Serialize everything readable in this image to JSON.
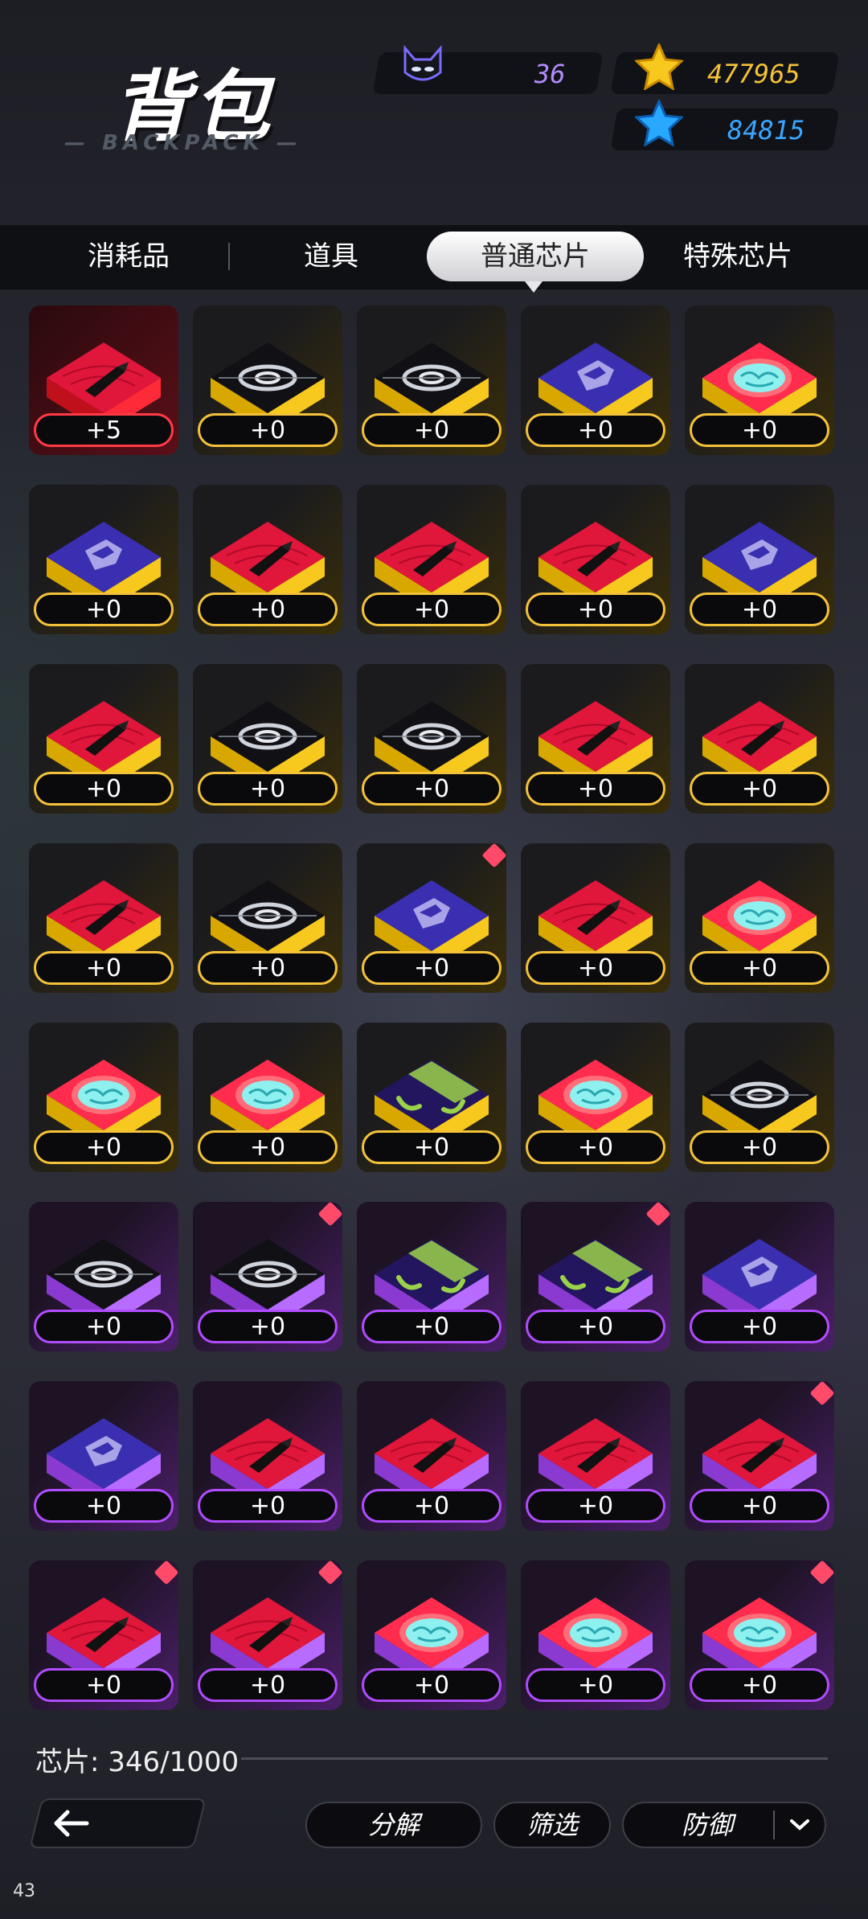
{
  "header": {
    "title": "背包",
    "subtitle": "BACKPACK",
    "energy_value": "36",
    "gold_value": "477965",
    "gem_value": "84815"
  },
  "tabs": [
    {
      "label": "消耗品",
      "active": false
    },
    {
      "label": "道具",
      "active": false
    },
    {
      "label": "普通芯片",
      "active": true
    },
    {
      "label": "特殊芯片",
      "active": false
    }
  ],
  "chips": [
    {
      "icon": "bullet",
      "tier": "red",
      "count": "+5",
      "new": false
    },
    {
      "icon": "vortex",
      "tier": "gold",
      "count": "+0",
      "new": false
    },
    {
      "icon": "vortex",
      "tier": "gold",
      "count": "+0",
      "new": false
    },
    {
      "icon": "shield-logo",
      "tier": "gold",
      "count": "+0",
      "new": false
    },
    {
      "icon": "brain",
      "tier": "gold",
      "count": "+0",
      "new": false
    },
    {
      "icon": "shield-logo",
      "tier": "gold",
      "count": "+0",
      "new": false
    },
    {
      "icon": "bullet",
      "tier": "gold",
      "count": "+0",
      "new": false
    },
    {
      "icon": "bullet",
      "tier": "gold",
      "count": "+0",
      "new": false
    },
    {
      "icon": "bullet",
      "tier": "gold",
      "count": "+0",
      "new": false
    },
    {
      "icon": "shield-logo",
      "tier": "gold",
      "count": "+0",
      "new": false
    },
    {
      "icon": "bullet",
      "tier": "gold",
      "count": "+0",
      "new": false
    },
    {
      "icon": "vortex",
      "tier": "gold",
      "count": "+0",
      "new": false
    },
    {
      "icon": "vortex",
      "tier": "gold",
      "count": "+0",
      "new": false
    },
    {
      "icon": "bullet",
      "tier": "gold",
      "count": "+0",
      "new": false
    },
    {
      "icon": "bullet",
      "tier": "gold",
      "count": "+0",
      "new": false
    },
    {
      "icon": "bullet",
      "tier": "gold",
      "count": "+0",
      "new": false
    },
    {
      "icon": "vortex",
      "tier": "gold",
      "count": "+0",
      "new": false
    },
    {
      "icon": "shield-logo",
      "tier": "gold",
      "count": "+0",
      "new": true
    },
    {
      "icon": "bullet",
      "tier": "gold",
      "count": "+0",
      "new": false
    },
    {
      "icon": "brain",
      "tier": "gold",
      "count": "+0",
      "new": false
    },
    {
      "icon": "brain",
      "tier": "gold",
      "count": "+0",
      "new": false
    },
    {
      "icon": "brain",
      "tier": "gold",
      "count": "+0",
      "new": false
    },
    {
      "icon": "dots-face",
      "tier": "gold",
      "count": "+0",
      "new": false
    },
    {
      "icon": "brain",
      "tier": "gold",
      "count": "+0",
      "new": false
    },
    {
      "icon": "vortex",
      "tier": "gold",
      "count": "+0",
      "new": false
    },
    {
      "icon": "vortex",
      "tier": "purple",
      "count": "+0",
      "new": false
    },
    {
      "icon": "vortex",
      "tier": "purple",
      "count": "+0",
      "new": true
    },
    {
      "icon": "dots-face",
      "tier": "purple",
      "count": "+0",
      "new": false
    },
    {
      "icon": "dots-face",
      "tier": "purple",
      "count": "+0",
      "new": true
    },
    {
      "icon": "shield-logo",
      "tier": "purple",
      "count": "+0",
      "new": false
    },
    {
      "icon": "shield-logo",
      "tier": "purple",
      "count": "+0",
      "new": false
    },
    {
      "icon": "bullet",
      "tier": "purple",
      "count": "+0",
      "new": false
    },
    {
      "icon": "bullet",
      "tier": "purple",
      "count": "+0",
      "new": false
    },
    {
      "icon": "bullet",
      "tier": "purple",
      "count": "+0",
      "new": false
    },
    {
      "icon": "bullet",
      "tier": "purple",
      "count": "+0",
      "new": true
    },
    {
      "icon": "bullet",
      "tier": "purple",
      "count": "+0",
      "new": true
    },
    {
      "icon": "bullet",
      "tier": "purple",
      "count": "+0",
      "new": true
    },
    {
      "icon": "brain",
      "tier": "purple",
      "count": "+0",
      "new": false
    },
    {
      "icon": "brain",
      "tier": "purple",
      "count": "+0",
      "new": false
    },
    {
      "icon": "brain",
      "tier": "purple",
      "count": "+0",
      "new": true
    }
  ],
  "footer": {
    "capacity_label": "芯片: 346/1000",
    "decompose_label": "分解",
    "filter_label": "筛选",
    "sort_label": "防御"
  },
  "fps": "43",
  "colors": {
    "gold": "#f4c23a",
    "red": "#ff3a46",
    "purple": "#b14cff",
    "energy_text": "#b58cff",
    "gold_text": "#f4c23a",
    "gem_text": "#3aa6ff"
  }
}
